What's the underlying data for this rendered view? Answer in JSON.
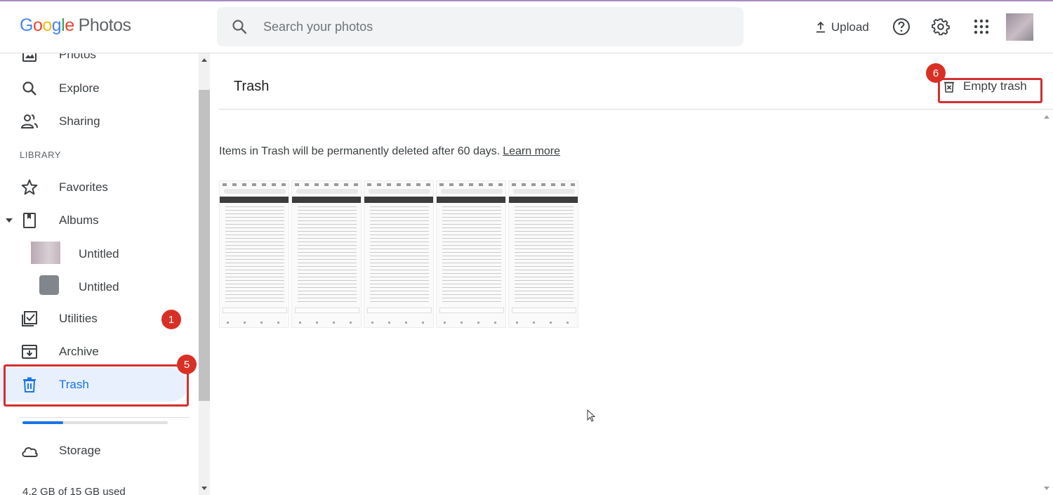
{
  "app": {
    "logo_google": "Google",
    "logo_photos": "Photos"
  },
  "search": {
    "placeholder": "Search your photos"
  },
  "header": {
    "upload_label": "Upload",
    "help_icon": "help-icon",
    "settings_icon": "gear-icon",
    "apps_icon": "apps-grid-icon"
  },
  "sidebar": {
    "items": [
      {
        "label": "Photos",
        "icon": "photo-icon"
      },
      {
        "label": "Explore",
        "icon": "search-icon"
      },
      {
        "label": "Sharing",
        "icon": "people-icon"
      }
    ],
    "library_label": "LIBRARY",
    "library_items": [
      {
        "label": "Favorites",
        "icon": "star-icon"
      },
      {
        "label": "Albums",
        "icon": "album-icon"
      }
    ],
    "albums": [
      {
        "label": "Untitled"
      },
      {
        "label": "Untitled"
      }
    ],
    "utilities_label": "Utilities",
    "utilities_badge": "1",
    "archive_label": "Archive",
    "trash_label": "Trash",
    "trash_badge": "5",
    "storage_label": "Storage",
    "storage_text": "4.2 GB of 15 GB used",
    "storage_fraction": 0.28
  },
  "main": {
    "title": "Trash",
    "empty_trash_label": "Empty trash",
    "empty_trash_badge": "6",
    "info_text": "Items in Trash will be permanently deleted after 60 days.",
    "learn_more": "Learn more",
    "thumbnail_count_visible": 5
  },
  "colors": {
    "accent": "#1a73e8",
    "highlight_red": "#d32f2f",
    "badge_red": "#d93025",
    "selected_bg": "#e8f0fe"
  }
}
